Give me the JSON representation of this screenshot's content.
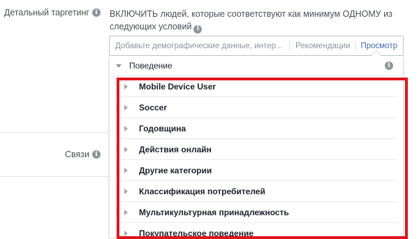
{
  "labels": {
    "detailed_targeting": "Детальный таргетинг",
    "connections": "Связи"
  },
  "intro": {
    "text": "ВКЛЮЧИТЬ людей, которые соответствуют как минимум ОДНОМУ из следующих условий"
  },
  "search": {
    "placeholder": "Добавьте демографические данные, интер...",
    "suggestions_label": "Рекомендации",
    "browse_label": "Просмотр"
  },
  "dropdown": {
    "category": "Поведение",
    "items": [
      {
        "label": "Mobile Device User"
      },
      {
        "label": "Soccer"
      },
      {
        "label": "Годовщина"
      },
      {
        "label": "Действия онлайн"
      },
      {
        "label": "Другие категории"
      },
      {
        "label": "Классификация потребителей"
      },
      {
        "label": "Мультикультурная принадлежность"
      },
      {
        "label": "Покупательское поведение"
      }
    ]
  },
  "colors": {
    "highlight_frame": "#e1141c",
    "link": "#4267b2"
  },
  "icons": {
    "info": "info-icon",
    "collapse": "caret-down-icon",
    "expand": "caret-right-icon"
  }
}
